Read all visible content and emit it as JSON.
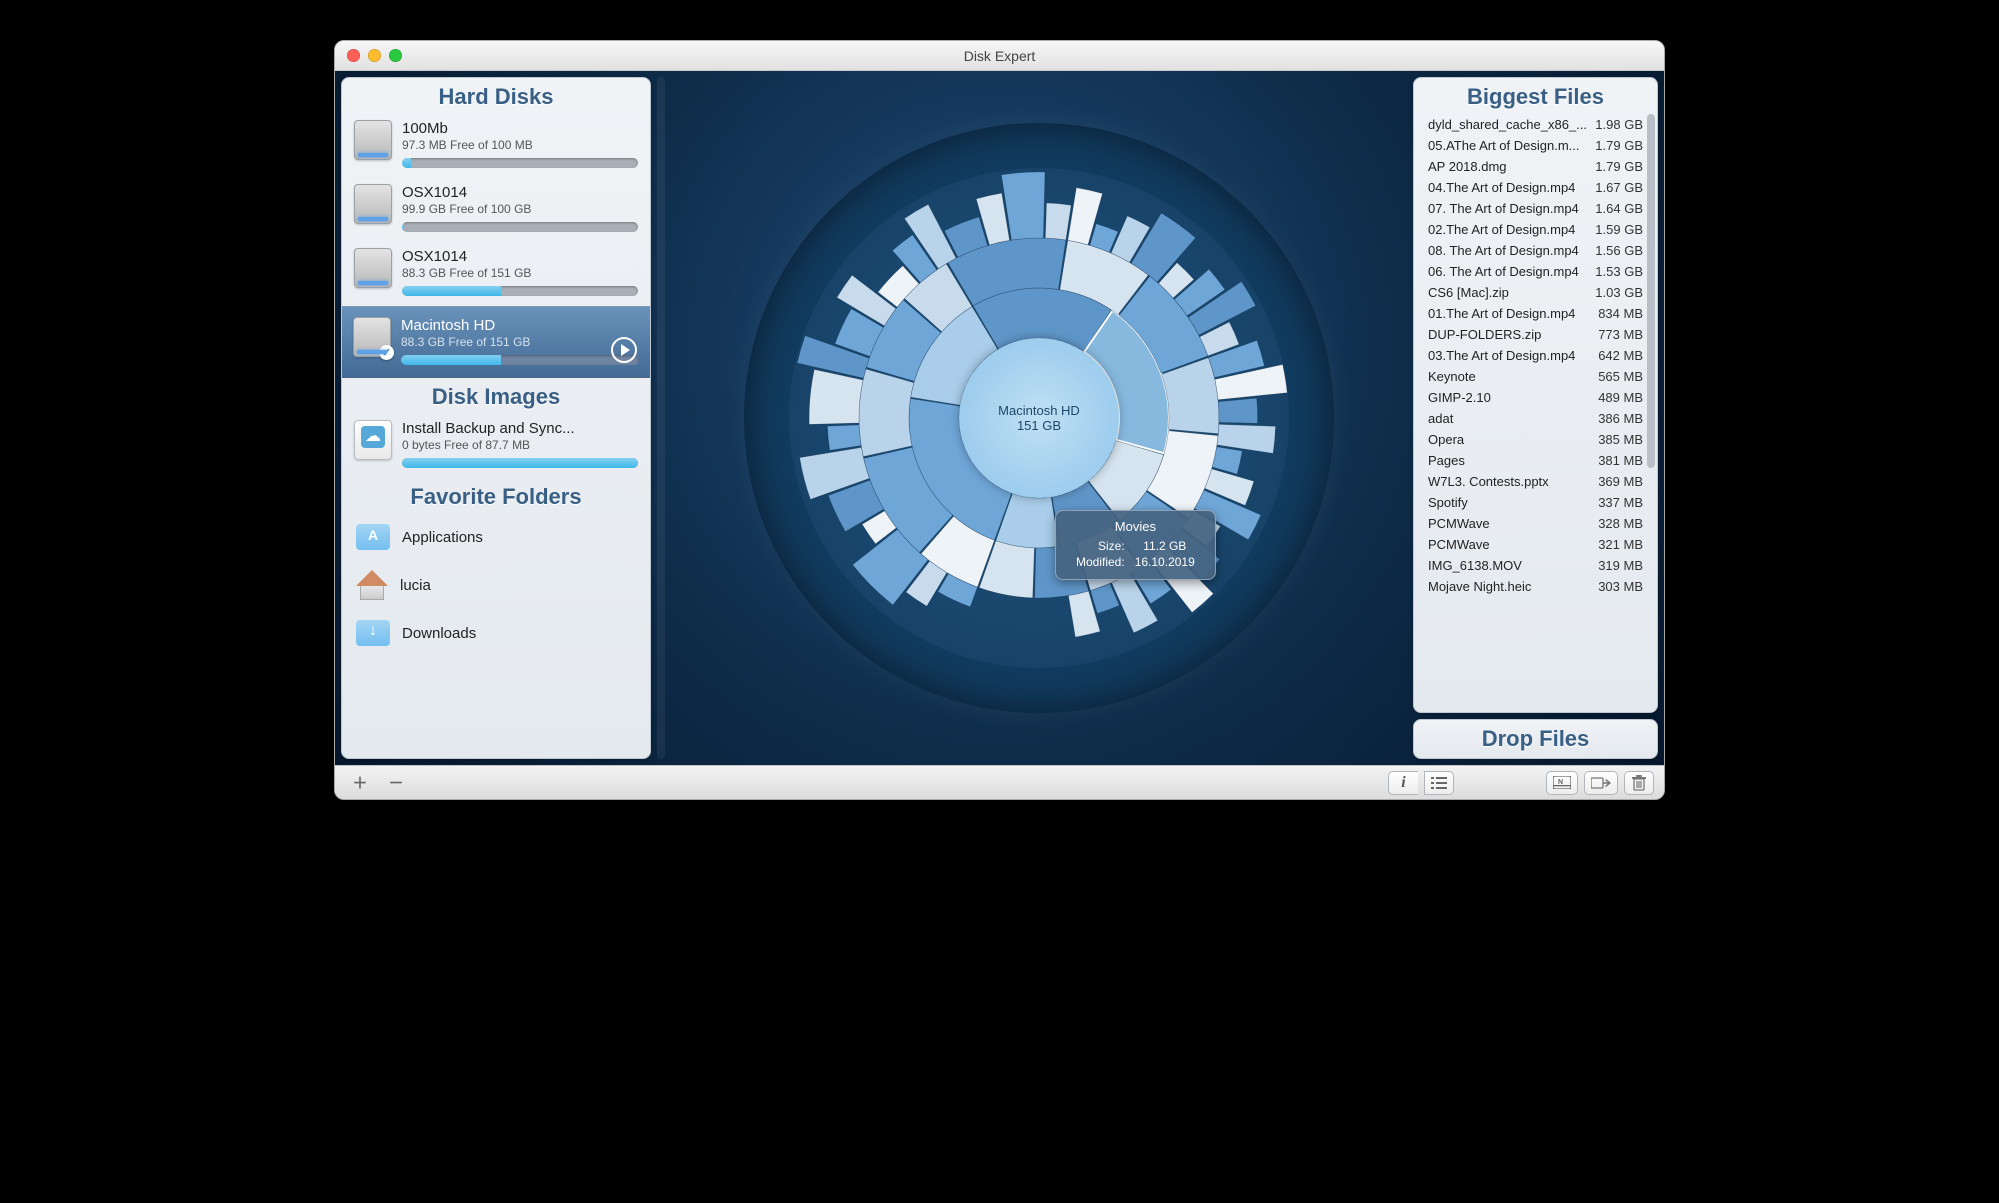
{
  "window_title": "Disk Expert",
  "sidebar": {
    "sections": {
      "hard_disks": "Hard Disks",
      "disk_images": "Disk Images",
      "favorites": "Favorite Folders"
    },
    "disks": [
      {
        "name": "100Mb",
        "sub": "97.3 MB Free of 100 MB",
        "fill_pct": 4,
        "selected": false
      },
      {
        "name": "OSX1014",
        "sub": "99.9 GB Free of 100 GB",
        "fill_pct": 1,
        "selected": false
      },
      {
        "name": "OSX1014",
        "sub": "88.3 GB Free of 151 GB",
        "fill_pct": 42,
        "selected": false
      },
      {
        "name": "Macintosh HD",
        "sub": "88.3 GB Free of 151 GB",
        "fill_pct": 42,
        "selected": true
      }
    ],
    "images": [
      {
        "name": "Install Backup and Sync...",
        "sub": "0 bytes Free of 87.7 MB",
        "fill_pct": 100
      }
    ],
    "favorites": [
      {
        "icon": "apps",
        "label": "Applications"
      },
      {
        "icon": "home",
        "label": "lucia"
      },
      {
        "icon": "downloads",
        "label": "Downloads"
      }
    ]
  },
  "sunburst": {
    "center_name": "Macintosh HD",
    "center_size": "151 GB",
    "tooltip": {
      "title": "Movies",
      "size_label": "Size:",
      "size_value": "11.2 GB",
      "mod_label": "Modified:",
      "mod_value": "16.10.2019"
    }
  },
  "biggest": {
    "title": "Biggest Files",
    "files": [
      {
        "name": "dyld_shared_cache_x86_...",
        "size": "1.98 GB"
      },
      {
        "name": "05.AThe Art of Design.m...",
        "size": "1.79 GB"
      },
      {
        "name": "AP 2018.dmg",
        "size": "1.79 GB"
      },
      {
        "name": "04.The Art of Design.mp4",
        "size": "1.67 GB"
      },
      {
        "name": "07. The Art of Design.mp4",
        "size": "1.64 GB"
      },
      {
        "name": "02.The Art of Design.mp4",
        "size": "1.59 GB"
      },
      {
        "name": "08. The Art of Design.mp4",
        "size": "1.56 GB"
      },
      {
        "name": "06. The Art of Design.mp4",
        "size": "1.53 GB"
      },
      {
        "name": "CS6 [Mac].zip",
        "size": "1.03 GB"
      },
      {
        "name": "01.The Art of Design.mp4",
        "size": "834 MB"
      },
      {
        "name": "DUP-FOLDERS.zip",
        "size": "773 MB"
      },
      {
        "name": "03.The Art of Design.mp4",
        "size": "642 MB"
      },
      {
        "name": "Keynote",
        "size": "565 MB"
      },
      {
        "name": "GIMP-2.10",
        "size": "489 MB"
      },
      {
        "name": "adat",
        "size": "386 MB"
      },
      {
        "name": "Opera",
        "size": "385 MB"
      },
      {
        "name": "Pages",
        "size": "381 MB"
      },
      {
        "name": "W7L3. Contests.pptx",
        "size": "369 MB"
      },
      {
        "name": "Spotify",
        "size": "337 MB"
      },
      {
        "name": "PCMWave",
        "size": "328 MB"
      },
      {
        "name": "PCMWave",
        "size": "321 MB"
      },
      {
        "name": "IMG_6138.MOV",
        "size": "319 MB"
      },
      {
        "name": "Mojave Night.heic",
        "size": "303 MB"
      }
    ]
  },
  "drop_label": "Drop Files",
  "chart_data": {
    "type": "sunburst-approx",
    "note": "Approximate angular extents read from screenshot; three visible ring levels around center disk.",
    "center": {
      "label": "Macintosh HD",
      "size_gb": 151
    },
    "rings": [
      {
        "level": 1,
        "segments": [
          {
            "color": "#6fa6d8",
            "span_pct": 22
          },
          {
            "color": "#a9cdea",
            "span_pct": 14
          },
          {
            "color": "#5f96c9",
            "span_pct": 18
          },
          {
            "color": "#87b9df",
            "span_pct": 20,
            "highlight": true,
            "label": "Movies",
            "size_gb": 11.2
          },
          {
            "color": "#d6e4ef",
            "span_pct": 10
          },
          {
            "color": "#5f96c9",
            "span_pct": 8
          },
          {
            "color": "#a9cdea",
            "span_pct": 8
          }
        ]
      },
      {
        "level": 2,
        "segments": [
          {
            "color": "#eef3f7",
            "span_pct": 6
          },
          {
            "color": "#6fa6d8",
            "span_pct": 10
          },
          {
            "color": "#b9d4ea",
            "span_pct": 8
          },
          {
            "color": "#6fa6d8",
            "span_pct": 7
          },
          {
            "color": "#c7dbed",
            "span_pct": 5
          },
          {
            "color": "#5f96c9",
            "span_pct": 11
          },
          {
            "color": "#d6e4ef",
            "span_pct": 8
          },
          {
            "color": "#6fa6d8",
            "span_pct": 9
          },
          {
            "color": "#b9d4ea",
            "span_pct": 7
          },
          {
            "color": "#eef3f7",
            "span_pct": 8
          },
          {
            "color": "#6fa6d8",
            "span_pct": 6
          },
          {
            "color": "#c7dbed",
            "span_pct": 5
          },
          {
            "color": "#5f96c9",
            "span_pct": 5
          },
          {
            "color": "#d6e4ef",
            "span_pct": 5
          }
        ]
      },
      {
        "level": 3,
        "segments": [
          {
            "color": "#6fa6d8",
            "span_pct": 3
          },
          {
            "color": "#c7dbed",
            "span_pct": 2
          },
          {
            "color": "#6fa6d8",
            "span_pct": 4
          },
          {
            "color": "#eef3f7",
            "span_pct": 2
          },
          {
            "color": "#5f96c9",
            "span_pct": 3
          },
          {
            "color": "#b9d4ea",
            "span_pct": 3
          },
          {
            "color": "#6fa6d8",
            "span_pct": 2
          },
          {
            "color": "#d6e4ef",
            "span_pct": 4
          },
          {
            "color": "#5f96c9",
            "span_pct": 2
          },
          {
            "color": "#6fa6d8",
            "span_pct": 3
          },
          {
            "color": "#c7dbed",
            "span_pct": 2
          },
          {
            "color": "#eef3f7",
            "span_pct": 3
          },
          {
            "color": "#6fa6d8",
            "span_pct": 2
          },
          {
            "color": "#b9d4ea",
            "span_pct": 2
          },
          {
            "color": "#5f96c9",
            "span_pct": 3
          },
          {
            "color": "#d6e4ef",
            "span_pct": 2
          },
          {
            "color": "#6fa6d8",
            "span_pct": 3
          },
          {
            "color": "#c7dbed",
            "span_pct": 2
          },
          {
            "color": "#eef3f7",
            "span_pct": 2
          },
          {
            "color": "#6fa6d8",
            "span_pct": 2
          },
          {
            "color": "#b9d4ea",
            "span_pct": 2
          },
          {
            "color": "#5f96c9",
            "span_pct": 3
          },
          {
            "color": "#d6e4ef",
            "span_pct": 2
          },
          {
            "color": "#6fa6d8",
            "span_pct": 2
          },
          {
            "color": "#5f96c9",
            "span_pct": 2
          },
          {
            "color": "#c7dbed",
            "span_pct": 2
          },
          {
            "color": "#6fa6d8",
            "span_pct": 2
          },
          {
            "color": "#eef3f7",
            "span_pct": 2
          },
          {
            "color": "#5f96c9",
            "span_pct": 2
          },
          {
            "color": "#b9d4ea",
            "span_pct": 2
          },
          {
            "color": "#6fa6d8",
            "span_pct": 2
          },
          {
            "color": "#d6e4ef",
            "span_pct": 2
          },
          {
            "color": "#6fa6d8",
            "span_pct": 2
          },
          {
            "color": "#c7dbed",
            "span_pct": 2
          },
          {
            "color": "#5f96c9",
            "span_pct": 2
          },
          {
            "color": "#eef3f7",
            "span_pct": 2
          },
          {
            "color": "#6fa6d8",
            "span_pct": 2
          },
          {
            "color": "#b9d4ea",
            "span_pct": 2
          },
          {
            "color": "#5f96c9",
            "span_pct": 2
          },
          {
            "color": "#d6e4ef",
            "span_pct": 2
          }
        ]
      }
    ]
  }
}
